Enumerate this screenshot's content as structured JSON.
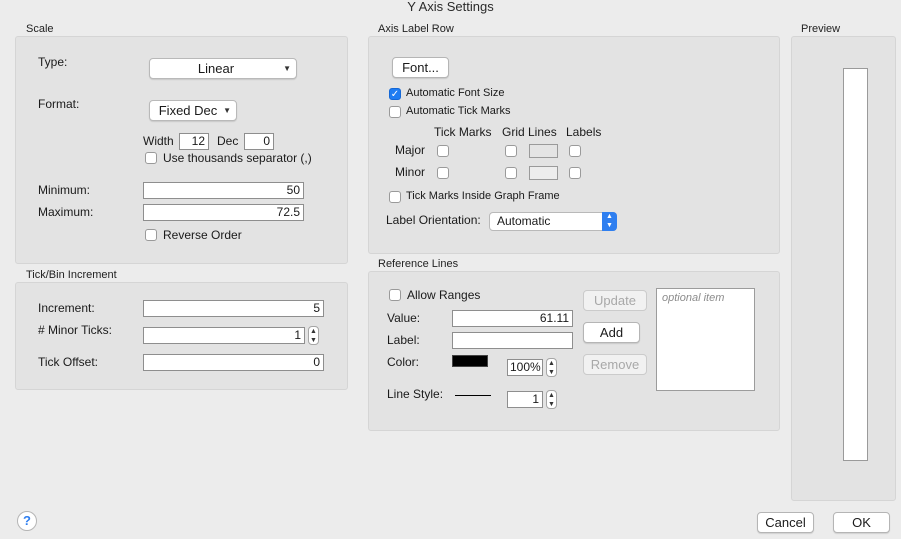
{
  "window": {
    "title": "Y Axis Settings"
  },
  "scale": {
    "title": "Scale",
    "type_label": "Type:",
    "type_value": "Linear",
    "format_label": "Format:",
    "format_value": "Fixed Dec",
    "width_label": "Width",
    "width_value": "12",
    "dec_label": "Dec",
    "dec_value": "0",
    "thousands_label": "Use thousands separator (,)",
    "thousands_checked": false,
    "minimum_label": "Minimum:",
    "minimum_value": "50",
    "maximum_label": "Maximum:",
    "maximum_value": "72.5",
    "reverse_label": "Reverse Order",
    "reverse_checked": false
  },
  "tick": {
    "title": "Tick/Bin Increment",
    "increment_label": "Increment:",
    "increment_value": "5",
    "minor_label": "# Minor Ticks:",
    "minor_value": "1",
    "offset_label": "Tick Offset:",
    "offset_value": "0"
  },
  "axis_label_row": {
    "title": "Axis Label Row",
    "font_button": "Font...",
    "auto_font_label": "Automatic Font Size",
    "auto_font_checked": true,
    "auto_tick_label": "Automatic Tick Marks",
    "auto_tick_checked": false,
    "col_tick_marks": "Tick Marks",
    "col_grid_lines": "Grid Lines",
    "col_labels": "Labels",
    "row_major": "Major",
    "row_minor": "Minor",
    "inside_label": "Tick Marks Inside Graph Frame",
    "inside_checked": false,
    "orientation_label": "Label Orientation:",
    "orientation_value": "Automatic"
  },
  "reference_lines": {
    "title": "Reference Lines",
    "allow_ranges_label": "Allow Ranges",
    "allow_ranges_checked": false,
    "value_label": "Value:",
    "value_value": "61.11",
    "label_label": "Label:",
    "label_value": "",
    "color_label": "Color:",
    "color_value": "#000000",
    "opacity_value": "100%",
    "line_style_label": "Line Style:",
    "line_width_value": "1",
    "update_button": "Update",
    "add_button": "Add",
    "remove_button": "Remove",
    "list_placeholder": "optional item"
  },
  "preview": {
    "title": "Preview"
  },
  "footer": {
    "help": "?",
    "cancel": "Cancel",
    "ok": "OK"
  },
  "colors": {
    "accent": "#1e7cf2",
    "panel": "#e3e3e3",
    "background": "#ececec"
  },
  "icons": [
    "checkmark-icon",
    "chevron-down-icon",
    "stepper-up-icon",
    "stepper-down-icon",
    "help-icon"
  ]
}
